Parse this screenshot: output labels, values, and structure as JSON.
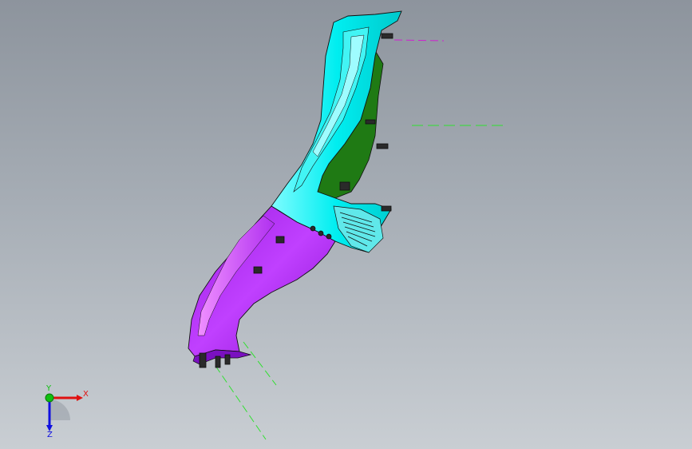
{
  "viewport": {
    "background_top": "#8d949d",
    "background_bottom": "#c9ced3"
  },
  "model": {
    "upper_part_color": "#00f0f0",
    "lower_part_color": "#a020f0",
    "inner_face_color": "#1a7a10",
    "edge_color": "#1a1a1a",
    "centerline_colors": [
      "#d020d0",
      "#30e030"
    ]
  },
  "triad": {
    "x_label": "X",
    "y_label": "Y",
    "z_label": "Z",
    "x_color": "#e01010",
    "y_color": "#10c010",
    "z_color": "#1010e0"
  }
}
